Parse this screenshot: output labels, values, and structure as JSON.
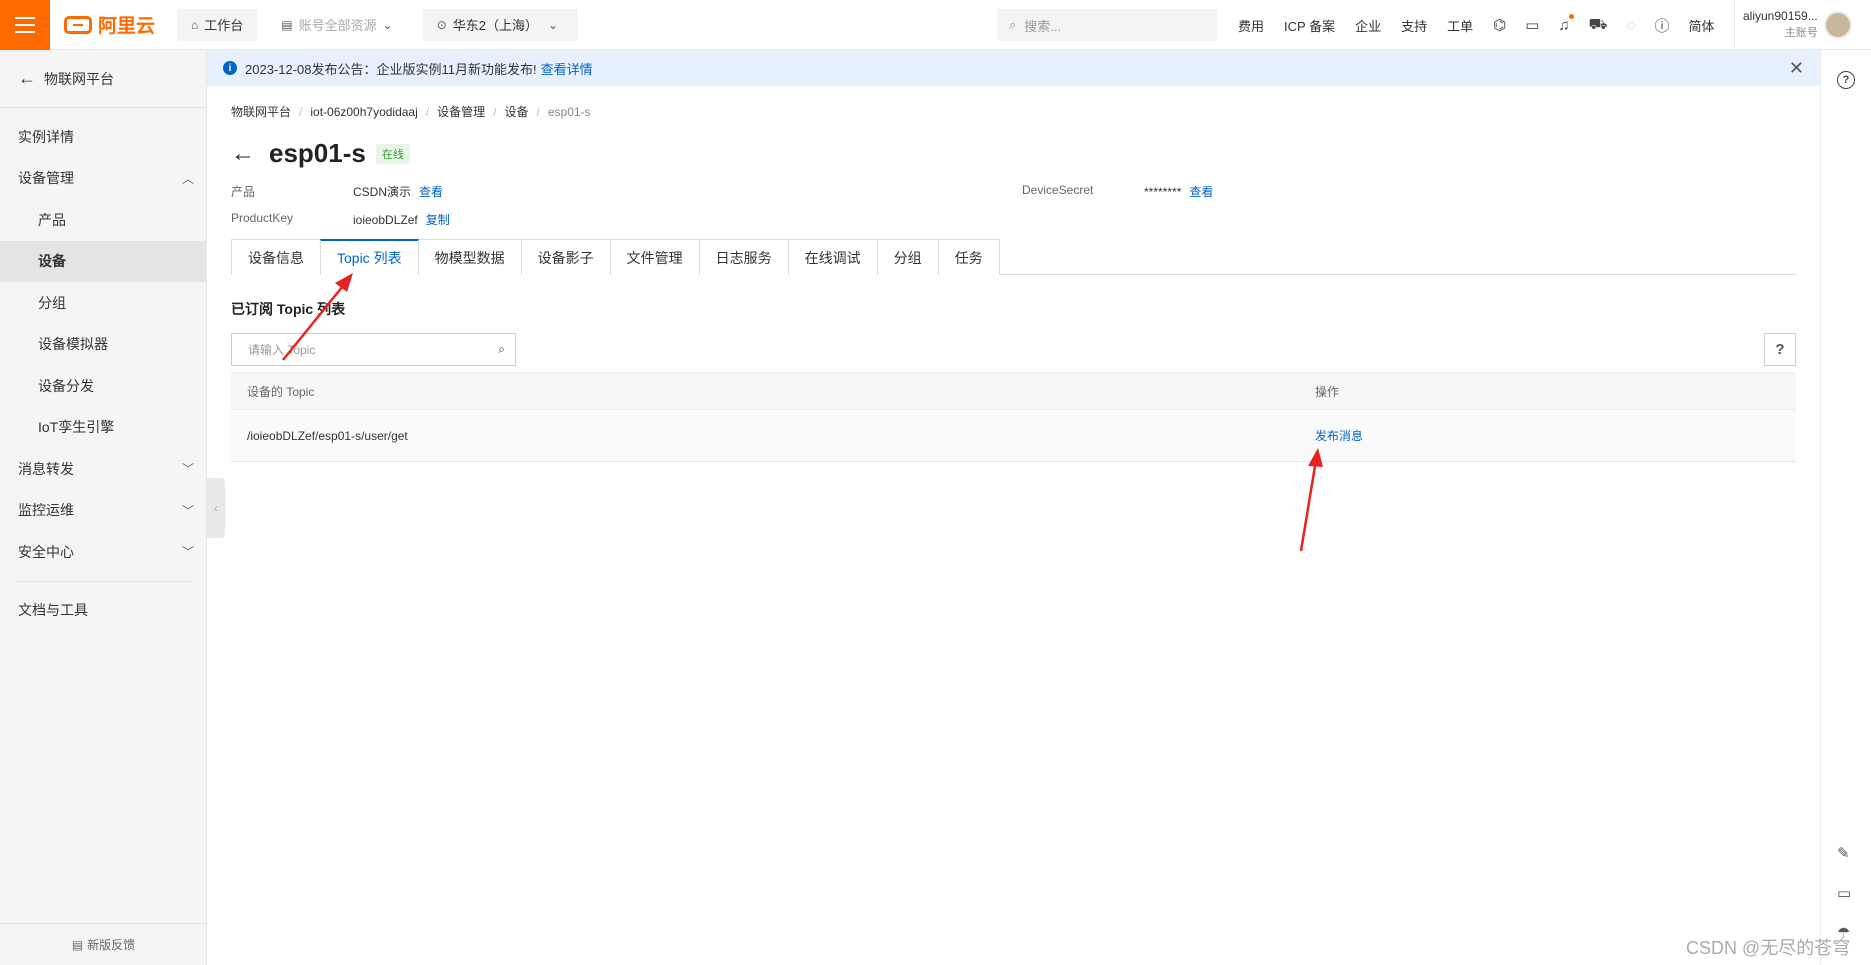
{
  "topbar": {
    "brand": "阿里云",
    "workbench": "工作台",
    "resources": "账号全部资源",
    "region": "华东2（上海）",
    "search_placeholder": "搜索...",
    "links": [
      "费用",
      "ICP 备案",
      "企业",
      "支持",
      "工单"
    ],
    "lang": "简体",
    "username": "aliyun90159...",
    "account_type": "主账号"
  },
  "sidebar": {
    "back_label": "物联网平台",
    "items": [
      {
        "label": "实例详情"
      },
      {
        "label": "设备管理",
        "chevron": "up"
      },
      {
        "label": "产品"
      },
      {
        "label": "设备"
      },
      {
        "label": "分组"
      },
      {
        "label": "设备模拟器"
      },
      {
        "label": "设备分发"
      },
      {
        "label": "IoT孪生引擎"
      },
      {
        "label": "消息转发",
        "chevron": "down"
      },
      {
        "label": "监控运维",
        "chevron": "down"
      },
      {
        "label": "安全中心",
        "chevron": "down"
      },
      {
        "label": "文档与工具"
      }
    ],
    "feedback": "新版反馈"
  },
  "notice": {
    "text": "2023-12-08发布公告：企业版实例11月新功能发布!",
    "link": "查看详情"
  },
  "breadcrumb": [
    "物联网平台",
    "iot-06z00h7yodidaaj",
    "设备管理",
    "设备",
    "esp01-s"
  ],
  "device": {
    "name": "esp01-s",
    "status": "在线",
    "product_label": "产品",
    "product_value": "CSDN演示",
    "product_action": "查看",
    "productkey_label": "ProductKey",
    "productkey_value": "ioieobDLZef",
    "productkey_action": "复制",
    "secret_label": "DeviceSecret",
    "secret_value": "********",
    "secret_action": "查看"
  },
  "tabs": [
    "设备信息",
    "Topic 列表",
    "物模型数据",
    "设备影子",
    "文件管理",
    "日志服务",
    "在线调试",
    "分组",
    "任务"
  ],
  "active_tab": "Topic 列表",
  "topics": {
    "section_title": "已订阅 Topic 列表",
    "search_placeholder": "请输入 Topic",
    "col_topic": "设备的 Topic",
    "col_action": "操作",
    "rows": [
      {
        "topic": "/ioieobDLZef/esp01-s/user/get",
        "action": "发布消息"
      }
    ]
  },
  "watermark": "CSDN @无尽的苍穹",
  "colors": {
    "brand": "#ff6a00",
    "link": "#0064c8",
    "annotation": "#e8231f"
  }
}
